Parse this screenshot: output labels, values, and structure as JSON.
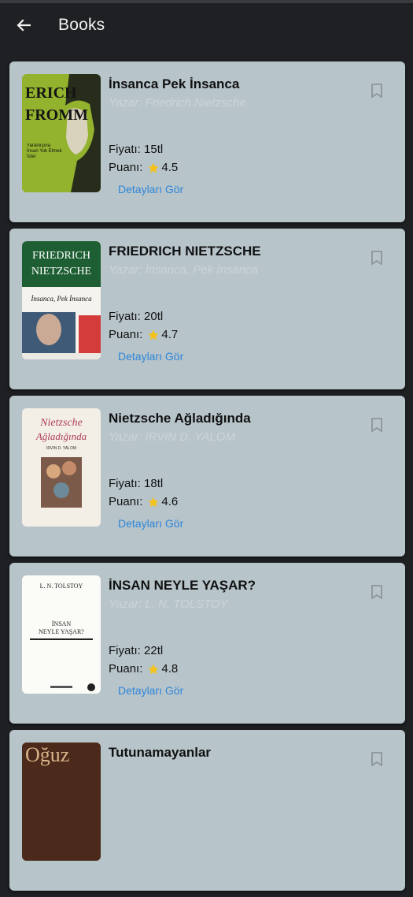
{
  "appbar": {
    "title": "Books"
  },
  "books": [
    {
      "title": "İnsanca Pek İnsanca",
      "author": "Yazar: Friedrich Nietzsche",
      "price": "Fiyatı: 15tl",
      "rating_label": "Puanı:",
      "rating": "4.5",
      "details_label": "Detayları Gör",
      "cover_text": [
        "ERICH",
        "FROMM",
        "Yaratılışına İnsan Yok Etmek İster"
      ]
    },
    {
      "title": "FRIEDRICH NIETZSCHE",
      "author": "Yazar: İnsanca, Pek İnsanca",
      "price": "Fiyatı: 20tl",
      "rating_label": "Puanı:",
      "rating": "4.7",
      "details_label": "Detayları Gör",
      "cover_text": [
        "FRIEDRICH",
        "NIETZSCHE",
        "İnsanca, Pek İnsanca"
      ]
    },
    {
      "title": "Nietzsche Ağladığında",
      "author": "Yazar: IRVIN D. YALOM",
      "price": "Fiyatı: 18tl",
      "rating_label": "Puanı:",
      "rating": "4.6",
      "details_label": "Detayları Gör",
      "cover_text": [
        "Nietzsche",
        "Ağladığında",
        "IRVIN D. YALOM"
      ]
    },
    {
      "title": "İNSAN NEYLE YAŞAR?",
      "author": "Yazar: L. N. TOLSTOY",
      "price": "Fiyatı: 22tl",
      "rating_label": "Puanı:",
      "rating": "4.8",
      "details_label": "Detayları Gör",
      "cover_text": [
        "L. N. TOLSTOY",
        "İNSAN",
        "NEYLE YAŞAR?"
      ]
    },
    {
      "title": "Tutunamayanlar",
      "cover_text": [
        "Oğuz"
      ]
    }
  ],
  "colors": {
    "background": "#1f2023",
    "card": "#b7c4ca",
    "author": "#ccd4d8",
    "link": "#2f86d8",
    "star": "#f4c21b"
  },
  "icons": {
    "back": "arrow-left-icon",
    "star": "star-icon",
    "bookmark": "bookmark-outline-icon"
  }
}
